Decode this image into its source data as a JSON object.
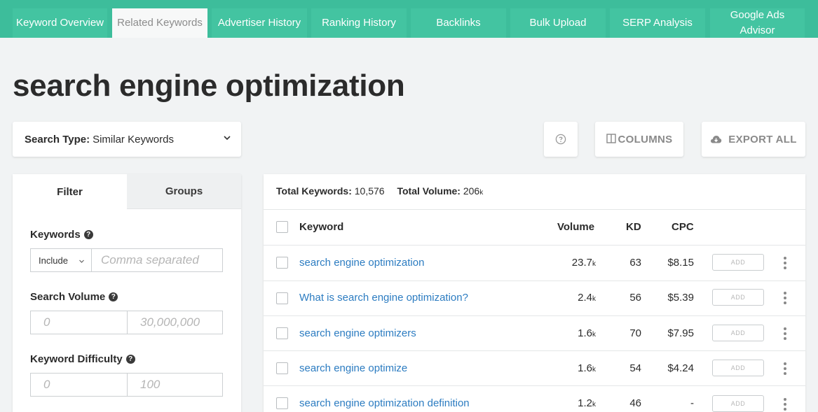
{
  "nav": {
    "tabs": [
      {
        "label": "Keyword Overview"
      },
      {
        "label": "Related Keywords"
      },
      {
        "label": "Advertiser History"
      },
      {
        "label": "Ranking History"
      },
      {
        "label": "Backlinks"
      },
      {
        "label": "Bulk Upload"
      },
      {
        "label": "SERP Analysis"
      },
      {
        "label": "Google Ads Advisor"
      }
    ],
    "active_tab": "Related Keywords"
  },
  "page_title": "search engine optimization",
  "search_type": {
    "label": "Search Type:",
    "value": "Similar Keywords"
  },
  "toolbar": {
    "help_icon": "question-circle-icon",
    "columns_label": "COLUMNS",
    "export_label": "EXPORT ALL"
  },
  "filter_panel": {
    "tabs": {
      "filter": "Filter",
      "groups": "Groups"
    },
    "keywords": {
      "label": "Keywords",
      "include_value": "Include",
      "placeholder": "Comma separated"
    },
    "search_volume": {
      "label": "Search Volume",
      "min_placeholder": "0",
      "max_placeholder": "30,000,000"
    },
    "keyword_difficulty": {
      "label": "Keyword Difficulty",
      "min_placeholder": "0",
      "max_placeholder": "100"
    }
  },
  "results": {
    "total_keywords_label": "Total Keywords:",
    "total_keywords_value": "10,576",
    "total_volume_label": "Total Volume:",
    "total_volume_value": "206",
    "total_volume_unit": "k",
    "columns": {
      "keyword": "Keyword",
      "volume": "Volume",
      "kd": "KD",
      "cpc": "CPC"
    },
    "add_label": "ADD",
    "rows": [
      {
        "keyword": "search engine optimization",
        "volume": "23.7",
        "unit": "k",
        "kd": "63",
        "cpc": "$8.15"
      },
      {
        "keyword": "What is search engine optimization?",
        "volume": "2.4",
        "unit": "k",
        "kd": "56",
        "cpc": "$5.39"
      },
      {
        "keyword": "search engine optimizers",
        "volume": "1.6",
        "unit": "k",
        "kd": "70",
        "cpc": "$7.95"
      },
      {
        "keyword": "search engine optimize",
        "volume": "1.6",
        "unit": "k",
        "kd": "54",
        "cpc": "$4.24"
      },
      {
        "keyword": "search engine optimization definition",
        "volume": "1.2",
        "unit": "k",
        "kd": "46",
        "cpc": "-"
      }
    ]
  }
}
